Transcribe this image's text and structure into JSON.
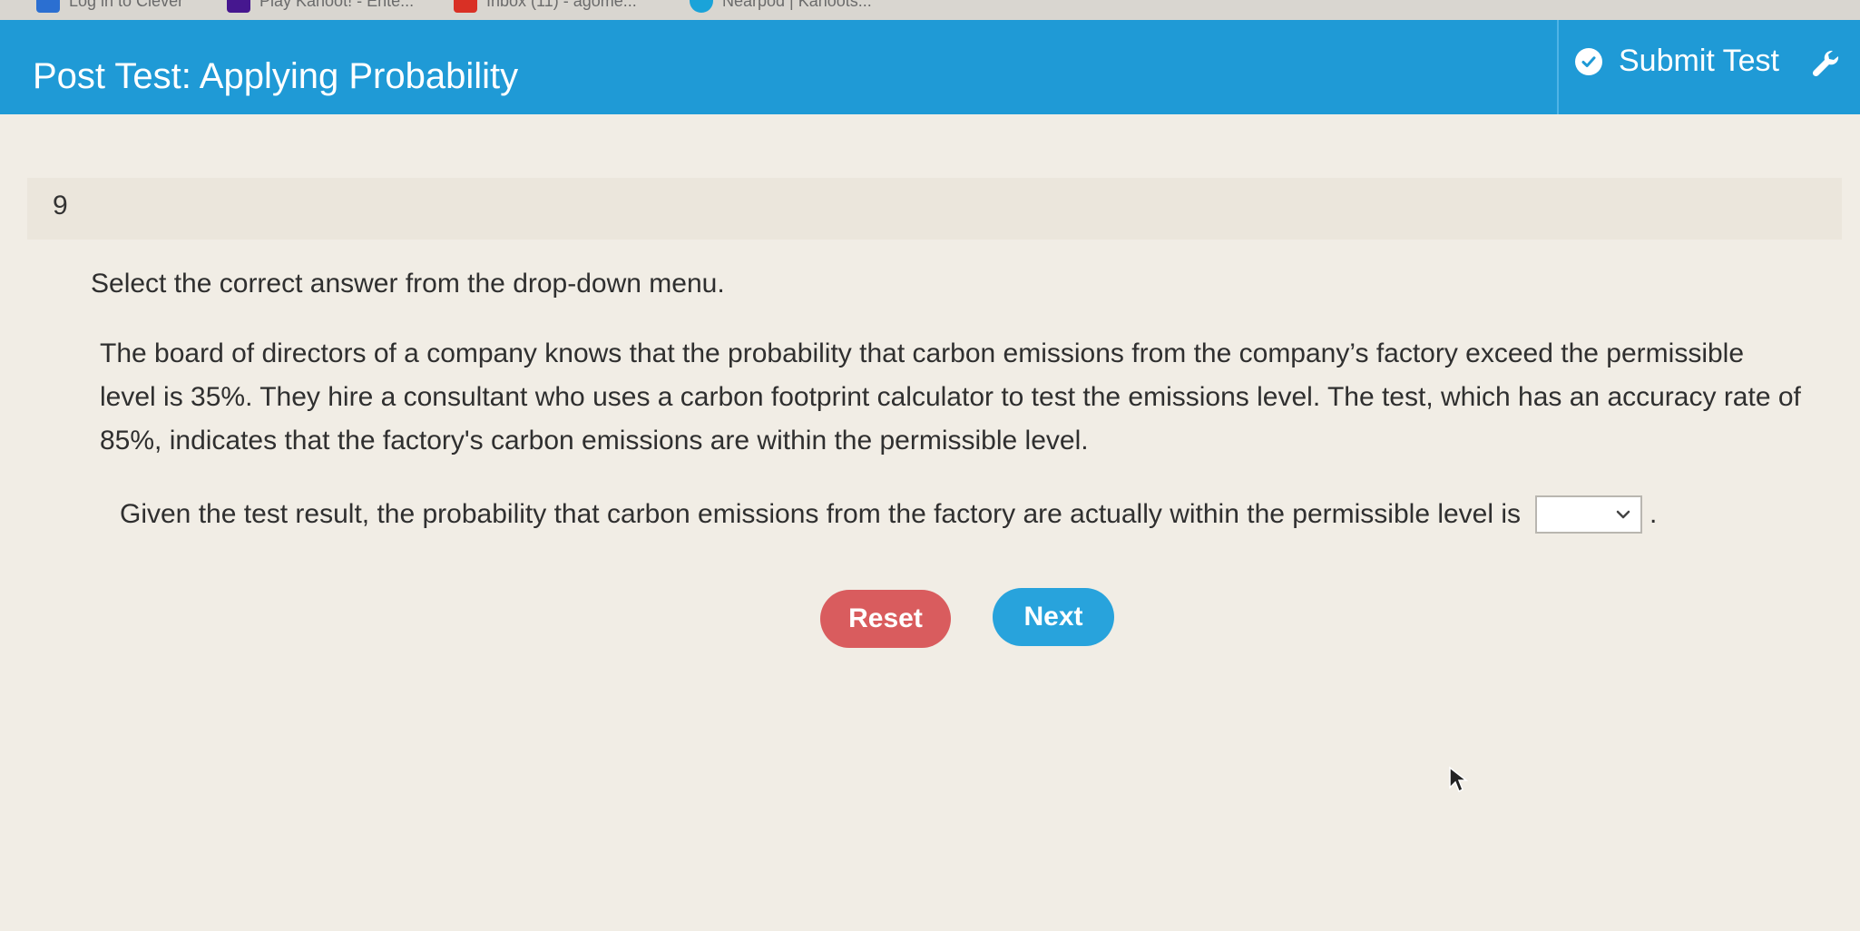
{
  "bookmarks": [
    {
      "label": "Log in to Clever",
      "icon": "clever-icon",
      "color": "#2b6fd1"
    },
    {
      "label": "Play Kahoot! - Ente...",
      "icon": "kahoot-icon",
      "color": "#46178f"
    },
    {
      "label": "Inbox (11) - agome...",
      "icon": "gmail-icon",
      "color": "#d93025"
    },
    {
      "label": "Nearpod | Kahoots...",
      "icon": "nearpod-icon",
      "color": "#1aa3d9"
    }
  ],
  "header": {
    "title": "Post Test: Applying Probability",
    "submit_label": "Submit Test",
    "background": "#1f9ad6"
  },
  "question": {
    "number": "9",
    "instructions": "Select the correct answer from the drop-down menu.",
    "passage": "The board of directors of a company knows that the probability that carbon emissions from the company’s factory exceed the permissible level is 35%. They hire a consultant who uses a carbon footprint calculator to test the emissions level. The test, which has an accuracy rate of 85%, indicates that the factory's carbon emissions are within the permissible level.",
    "prompt": "Given the test result, the probability that carbon emissions from the factory are actually within the permissible level is",
    "dropdown_value": "",
    "period": "."
  },
  "buttons": {
    "reset_label": "Reset",
    "next_label": "Next",
    "reset_color": "#d95c5e",
    "next_color": "#28a3dc"
  }
}
